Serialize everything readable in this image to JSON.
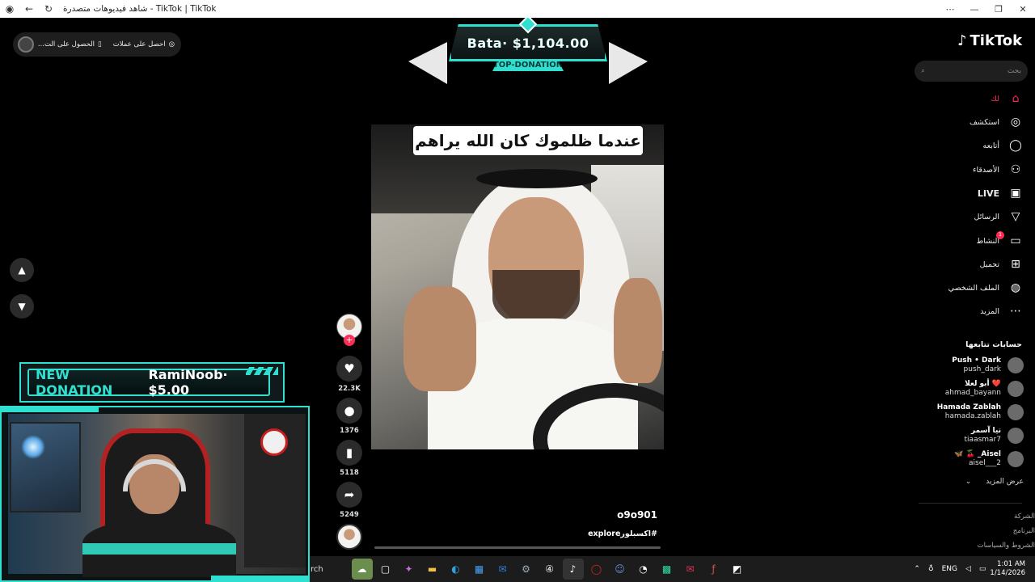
{
  "browser": {
    "title": "شاهد فيديوهات متصدرة - TikTok | TikTok"
  },
  "top_pill": {
    "items": [
      {
        "label": "احصل على عملات",
        "icon": "coin-icon"
      },
      {
        "label": "الحصول على الت...",
        "icon": "phone-icon"
      }
    ]
  },
  "stream_overlay": {
    "top_donation": {
      "amount": "Bata· $1,104.00",
      "label": "TOP-DONATION"
    },
    "new_donation": {
      "label": "NEW DONATION",
      "text": "RamiNoob· $5.00"
    }
  },
  "video": {
    "caption": "عندما ظلموك كان الله يراهم",
    "author": "o9o901",
    "hashtag": "#اكسبلورexplore"
  },
  "actions": {
    "likes": "22.3K",
    "comments": "1376",
    "saves": "5118",
    "shares": "5249"
  },
  "sidebar": {
    "logo": "TikTok",
    "search_placeholder": "بحث",
    "items": [
      {
        "label": "لك",
        "icon": "home-icon"
      },
      {
        "label": "استكشف",
        "icon": "compass-icon"
      },
      {
        "label": "أتابعه",
        "icon": "following-icon"
      },
      {
        "label": "الأصدقاء",
        "icon": "friends-icon"
      },
      {
        "label": "LIVE",
        "icon": "live-icon"
      },
      {
        "label": "الرسائل",
        "icon": "send-icon"
      },
      {
        "label": "النشاط",
        "icon": "activity-icon",
        "badge": "1"
      },
      {
        "label": "تحميل",
        "icon": "upload-icon"
      },
      {
        "label": "الملف الشخصي",
        "icon": "profile-icon"
      },
      {
        "label": "المزيد",
        "icon": "more-icon"
      }
    ],
    "following_heading": "حسابات تتابعها",
    "accounts": [
      {
        "name": "Push • Dark",
        "handle": "push_dark"
      },
      {
        "name": "أبو لعلا ❤️",
        "handle": "ahmad_bayann"
      },
      {
        "name": "Hamada Zablah",
        "handle": "hamada.zablah"
      },
      {
        "name": "تيا آسمر",
        "handle": "tiaasmar7"
      },
      {
        "name": "🦋 🍒 _Aisel",
        "handle": "aisel___2"
      }
    ],
    "see_more": "عرض المزيد",
    "footer": [
      "الشركة",
      "البرنامج",
      "الشروط والسياسات"
    ]
  },
  "taskbar": {
    "search_fragment": "rch",
    "lang": "ENG",
    "time": "1:01 AM",
    "date": "1/14/2026"
  }
}
